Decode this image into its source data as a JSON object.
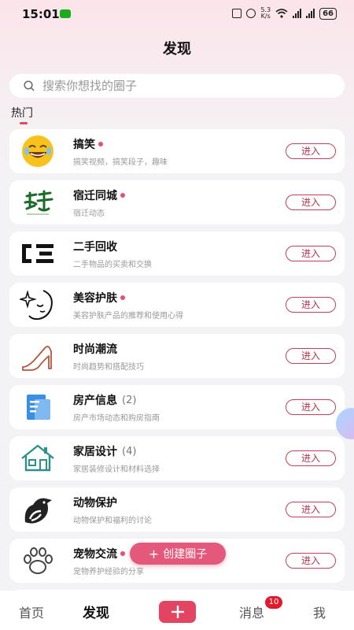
{
  "status": {
    "time": "15:01",
    "speed_value": "5.3",
    "speed_unit": "K/s",
    "battery": "66"
  },
  "page": {
    "title": "发现"
  },
  "search": {
    "placeholder": "搜索你想找的圈子"
  },
  "section": {
    "hot_label": "热门"
  },
  "circles": [
    {
      "name": "搞笑",
      "dot": true,
      "count": "",
      "desc": "搞笑视频，搞笑段子，趣味",
      "button": "进入",
      "icon": "laughing-face-icon"
    },
    {
      "name": "宿迁同城",
      "dot": true,
      "count": "",
      "desc": "宿迁动态",
      "button": "进入",
      "icon": "suqian-calligraphy-logo"
    },
    {
      "name": "二手回收",
      "dot": false,
      "count": "",
      "desc": "二手物品的买卖和交换",
      "button": "进入",
      "icon": "recycle-logo-icon"
    },
    {
      "name": "美容护肤",
      "dot": true,
      "count": "",
      "desc": "美容护肤产品的推荐和使用心得",
      "button": "进入",
      "icon": "beauty-face-icon"
    },
    {
      "name": "时尚潮流",
      "dot": false,
      "count": "",
      "desc": "时尚趋势和搭配技巧",
      "button": "进入",
      "icon": "high-heel-icon"
    },
    {
      "name": "房产信息",
      "dot": false,
      "count": "(2)",
      "desc": "房产市场动态和购房指南",
      "button": "进入",
      "icon": "document-icon"
    },
    {
      "name": "家居设计",
      "dot": false,
      "count": "(4)",
      "desc": "家居装修设计和材料选择",
      "button": "进入",
      "icon": "house-icon"
    },
    {
      "name": "动物保护",
      "dot": false,
      "count": "",
      "desc": "动物保护和福利的讨论",
      "button": "进入",
      "icon": "bird-icon"
    },
    {
      "name": "宠物交流",
      "dot": true,
      "count": "",
      "desc": "宠物养护经验的分享",
      "button": "进入",
      "icon": "paw-icon"
    }
  ],
  "create_button": {
    "plus": "+",
    "label": "创建圈子"
  },
  "tabbar": {
    "home": "首页",
    "discover": "发现",
    "messages": "消息",
    "messages_badge": "10",
    "me": "我"
  },
  "colors": {
    "accent": "#e24462",
    "button_border": "#c0405a",
    "dot": "#e55070",
    "badge": "#e0192d"
  }
}
